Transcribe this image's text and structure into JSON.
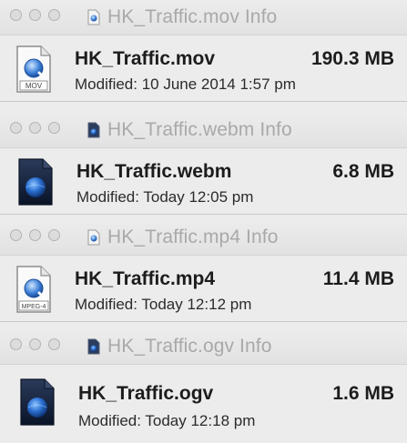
{
  "windows": [
    {
      "title": "HK_Traffic.mov Info",
      "file_name": "HK_Traffic.mov",
      "size": "190.3 MB",
      "modified": "Modified: 10 June 2014 1:57 pm",
      "icon": "quicktime-movie-icon",
      "icon_badge": "MOV"
    },
    {
      "title": "HK_Traffic.webm Info",
      "file_name": "HK_Traffic.webm",
      "size": "6.8 MB",
      "modified": "Modified: Today 12:05 pm",
      "icon": "generic-media-icon"
    },
    {
      "title": "HK_Traffic.mp4 Info",
      "file_name": "HK_Traffic.mp4",
      "size": "11.4 MB",
      "modified": "Modified: Today 12:12 pm",
      "icon": "quicktime-movie-icon",
      "icon_badge": "MPEG-4"
    },
    {
      "title": "HK_Traffic.ogv Info",
      "file_name": "HK_Traffic.ogv",
      "size": "1.6 MB",
      "modified": "Modified: Today 12:18 pm",
      "icon": "generic-media-icon"
    }
  ]
}
